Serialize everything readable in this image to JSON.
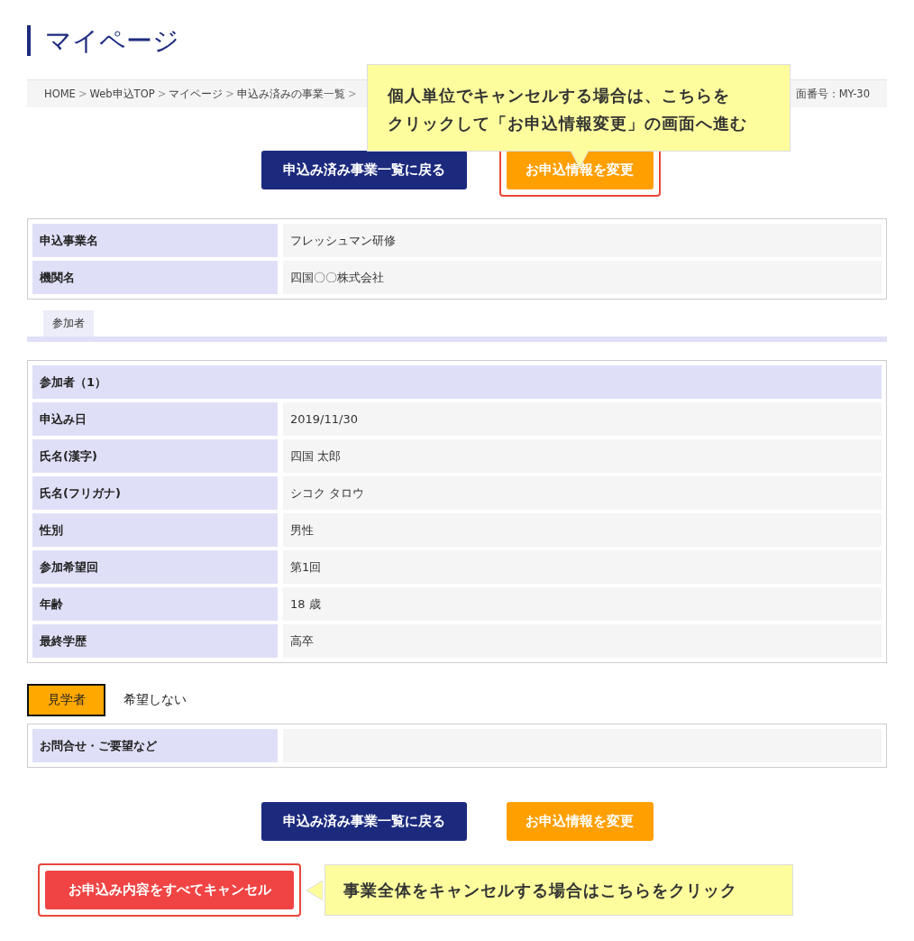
{
  "page_title": "マイページ",
  "breadcrumb": [
    {
      "kind": "link",
      "text": "HOME"
    },
    {
      "kind": "sep",
      "text": ">"
    },
    {
      "kind": "link",
      "text": "Web申込TOP"
    },
    {
      "kind": "sep",
      "text": ">"
    },
    {
      "kind": "link",
      "text": "マイページ"
    },
    {
      "kind": "sep",
      "text": ">"
    },
    {
      "kind": "link",
      "text": "申込み済みの事業一覧"
    },
    {
      "kind": "sep",
      "text": ">"
    }
  ],
  "screen_id": "面番号：MY-30",
  "top_callout": {
    "lines": [
      "個人単位でキャンセルする場合は、こちらを",
      "クリックして「お申込情報変更」の画面へ進む"
    ]
  },
  "buttons_top": [
    {
      "kind": "back",
      "label": "申込み済み事業一覧に戻る",
      "highlighted": false
    },
    {
      "kind": "edit",
      "label": "お申込情報を変更",
      "highlighted": true
    }
  ],
  "summary_table": [
    {
      "label": "申込事業名",
      "value": "フレッシュマン研修"
    },
    {
      "label": "機関名",
      "value": "四国〇〇株式会社"
    }
  ],
  "tabs": [
    {
      "label": "参加者",
      "selected": true
    }
  ],
  "participant": {
    "heading": "参加者（1）",
    "rows": [
      {
        "label": "申込み日",
        "value": "2019/11/30"
      },
      {
        "label": "氏名(漢字)",
        "value": "四国 太郎"
      },
      {
        "label": "氏名(フリガナ)",
        "value": "シコク タロウ"
      },
      {
        "label": "性別",
        "value": "男性"
      },
      {
        "label": "参加希望回",
        "value": "第1回"
      },
      {
        "label": "年齢",
        "value": "18 歳"
      },
      {
        "label": "最終学歴",
        "value": "高卒"
      }
    ]
  },
  "visitor": {
    "label": "見学者",
    "value": "希望しない"
  },
  "inquiry_table": [
    {
      "label": "お問合せ・ご要望など"
    }
  ],
  "buttons_bottom": [
    {
      "kind": "back",
      "label": "申込み済み事業一覧に戻る",
      "highlighted": false
    },
    {
      "kind": "edit",
      "label": "お申込情報を変更",
      "highlighted": false
    }
  ],
  "cancel": {
    "label": "お申込み内容をすべてキャンセル",
    "highlighted": true,
    "callout": "事業全体をキャンセルする場合はこちらをクリック"
  }
}
